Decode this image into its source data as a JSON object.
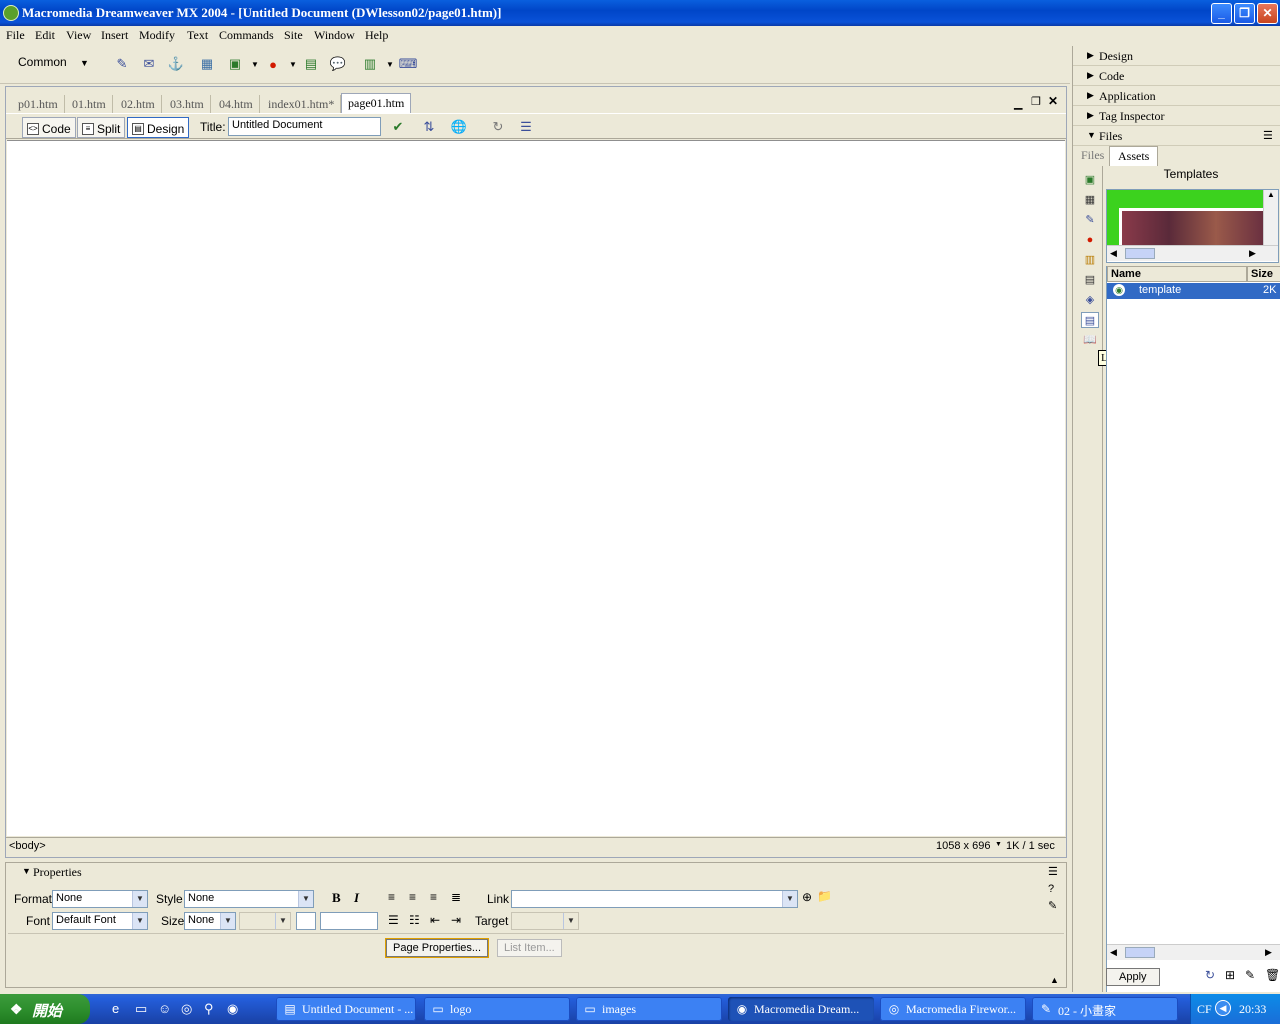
{
  "window": {
    "title": "Macromedia Dreamweaver MX 2004 - [Untitled Document (DWlesson02/page01.htm)]"
  },
  "menu": [
    "File",
    "Edit",
    "View",
    "Insert",
    "Modify",
    "Text",
    "Commands",
    "Site",
    "Window",
    "Help"
  ],
  "insert_bar": {
    "category": "Common"
  },
  "tabs": [
    "p01.htm",
    "01.htm",
    "02.htm",
    "03.htm",
    "04.htm",
    "index01.htm*",
    "page01.htm"
  ],
  "doc_toolbar": {
    "code": "Code",
    "split": "Split",
    "design": "Design",
    "title_label": "Title:",
    "title_value": "Untitled Document"
  },
  "status": {
    "tag": "<body>",
    "size": "1058 x 696",
    "download": "1K / 1 sec"
  },
  "properties": {
    "header": "Properties",
    "format_label": "Format",
    "format_value": "None",
    "style_label": "Style",
    "style_value": "None",
    "font_label": "Font",
    "font_value": "Default Font",
    "size_label": "Size",
    "size_value": "None",
    "link_label": "Link",
    "target_label": "Target",
    "bold": "B",
    "italic": "I",
    "page_properties": "Page Properties...",
    "list_item": "List Item..."
  },
  "panels": {
    "groups": [
      "Design",
      "Code",
      "Application",
      "Tag Inspector",
      "Files"
    ],
    "files_tabs": [
      "Files",
      "Assets"
    ],
    "assets_title": "Templates",
    "columns": [
      "Name",
      "Size"
    ],
    "row": {
      "name": "template",
      "size": "2K"
    },
    "tooltip": "Library",
    "apply": "Apply"
  },
  "taskbar": {
    "start": "開始",
    "tasks": [
      "Untitled Document - ...",
      "logo",
      "images",
      "Macromedia Dream...",
      "Macromedia Firewor...",
      "02 - 小畫家"
    ],
    "lang": "CF",
    "time": "20:33"
  }
}
